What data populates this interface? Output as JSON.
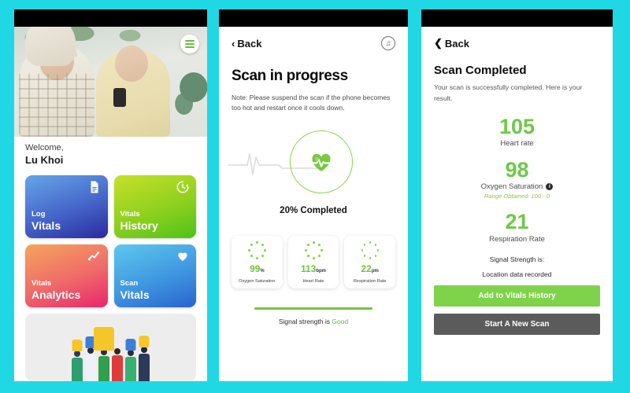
{
  "theme": {
    "background": "#20d8e4",
    "accent_green": "#7ed34a",
    "value_green": "#6ec948",
    "dark_button": "#5b5b5b"
  },
  "screen_home": {
    "menu_icon": "hamburger-icon",
    "welcome_label": "Welcome,",
    "user_name": "Lu Khoi",
    "tiles": [
      {
        "top": "Log",
        "bottom": "Vitals",
        "icon": "document-icon"
      },
      {
        "top": "Vitals",
        "bottom": "History",
        "icon": "history-clock-icon"
      },
      {
        "top": "Vitals",
        "bottom": "Analytics",
        "icon": "chart-line-icon"
      },
      {
        "top": "Scan",
        "bottom": "Vitals",
        "icon": "heart-icon"
      }
    ],
    "promo_alt": "people-thumbs-up-illustration"
  },
  "screen_scan": {
    "back_label": "Back",
    "back_icon": "chevron-left-icon",
    "music_icon": "music-note-icon",
    "title": "Scan in progress",
    "note": "Note: Please suspend the scan if the phone becomes too hot and restart once it cools down.",
    "progress_icon": "heart-pulse-icon",
    "progress_text": "20% Completed",
    "progress_percent": 20,
    "metrics": [
      {
        "value": "99",
        "unit": "%",
        "label": "Oxygen Saturation"
      },
      {
        "value": "113",
        "unit": "bpm",
        "label": "Heart Rate"
      },
      {
        "value": "22",
        "unit": "pm",
        "label": "Respiration Rate"
      }
    ],
    "signal_prefix": "Signal strength is ",
    "signal_value": "Good"
  },
  "screen_result": {
    "back_label": "Back",
    "back_icon": "chevron-left-icon",
    "title": "Scan Completed",
    "subtitle": "Your scan is successfully completed. Here is your result.",
    "results": [
      {
        "value": "105",
        "label": "Heart rate",
        "info": false,
        "range": ""
      },
      {
        "value": "98",
        "label": "Oxygen Saturation",
        "info": true,
        "range": "Range Obtained: 100 - 0"
      },
      {
        "value": "21",
        "label": "Respiration Rate",
        "info": false,
        "range": ""
      }
    ],
    "info_icon": "info-icon",
    "signal_strength_label": "Signal Strength is:",
    "location_label": "Location data recorded",
    "primary_button": "Add to Vitals History",
    "secondary_button": "Start A New Scan"
  }
}
